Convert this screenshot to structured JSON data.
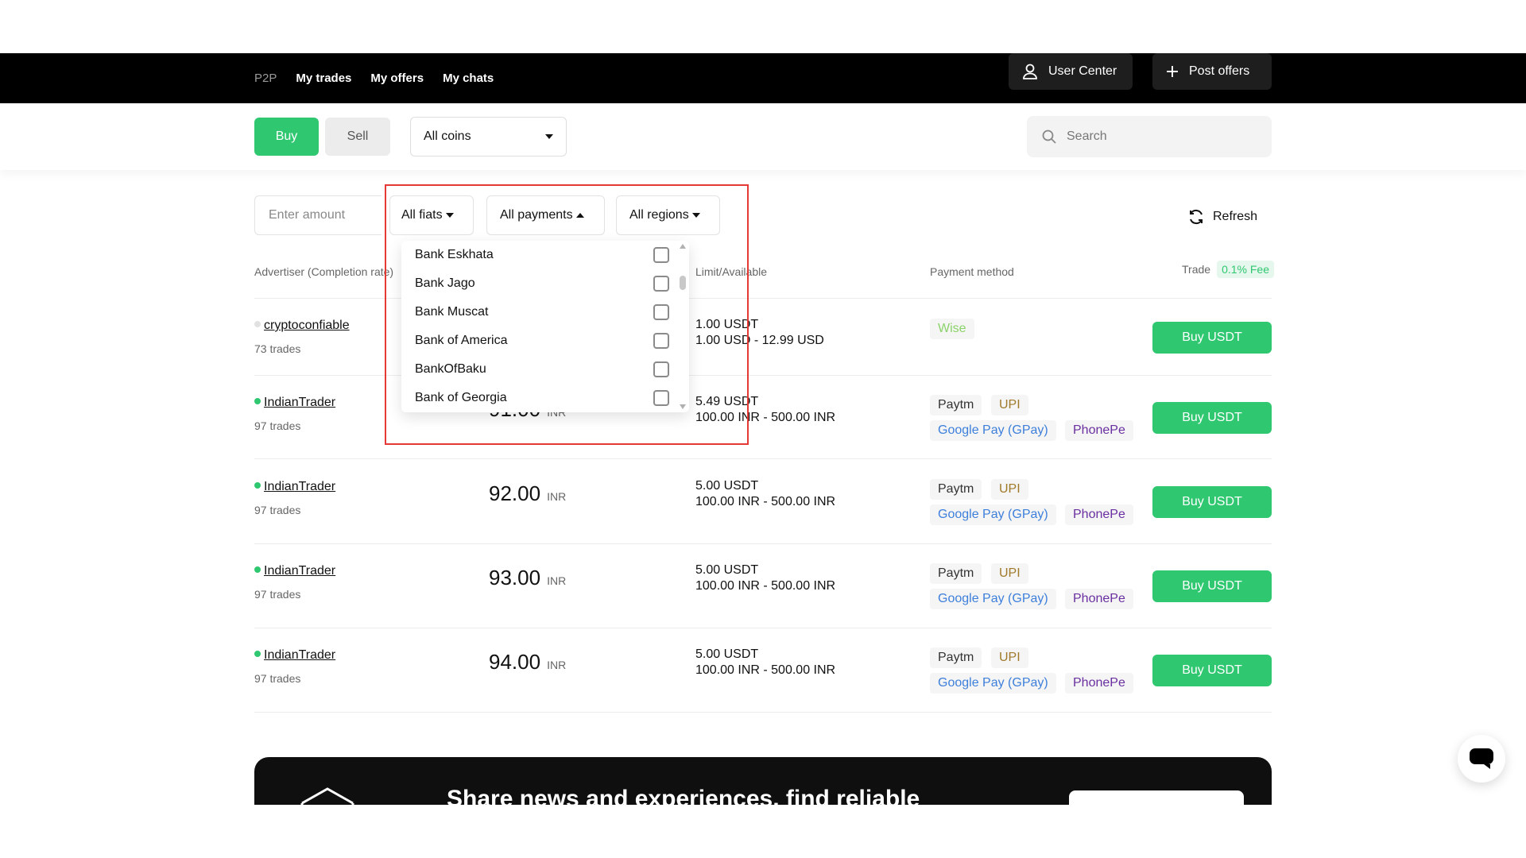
{
  "nav": {
    "p2p": "P2P",
    "my_trades": "My trades",
    "my_offers": "My offers",
    "my_chats": "My chats",
    "user_center": "User Center",
    "post_offers": "Post offers"
  },
  "filters": {
    "buy": "Buy",
    "sell": "Sell",
    "coins": "All coins",
    "search_placeholder": "Search",
    "amount_placeholder": "Enter amount",
    "fiats": "All fiats",
    "payments": "All payments",
    "regions": "All regions",
    "refresh": "Refresh"
  },
  "table_header": {
    "advertiser": "Advertiser (Completion rate)",
    "limit": "Limit/Available",
    "payment": "Payment method",
    "trade": "Trade",
    "fee": "0.1% Fee"
  },
  "dropdown_items": [
    "Bank Eskhata",
    "Bank Jago",
    "Bank Muscat",
    "Bank of America",
    "BankOfBaku",
    "Bank of Georgia"
  ],
  "rows": [
    {
      "name": "cryptoconfiable",
      "trades": "73 trades",
      "price": "",
      "currency": "",
      "available": "1.00 USDT",
      "range": "1.00 USD - 12.99 USD",
      "payments": [
        "Wise"
      ],
      "action": "Buy USDT"
    },
    {
      "name": "IndianTrader",
      "trades": "97 trades",
      "price": "91.00",
      "currency": "INR",
      "available": "5.49 USDT",
      "range": "100.00 INR - 500.00 INR",
      "payments": [
        "Paytm",
        "UPI",
        "Google Pay (GPay)",
        "PhonePe"
      ],
      "action": "Buy USDT"
    },
    {
      "name": "IndianTrader",
      "trades": "97 trades",
      "price": "92.00",
      "currency": "INR",
      "available": "5.00 USDT",
      "range": "100.00 INR - 500.00 INR",
      "payments": [
        "Paytm",
        "UPI",
        "Google Pay (GPay)",
        "PhonePe"
      ],
      "action": "Buy USDT"
    },
    {
      "name": "IndianTrader",
      "trades": "97 trades",
      "price": "93.00",
      "currency": "INR",
      "available": "5.00 USDT",
      "range": "100.00 INR - 500.00 INR",
      "payments": [
        "Paytm",
        "UPI",
        "Google Pay (GPay)",
        "PhonePe"
      ],
      "action": "Buy USDT"
    },
    {
      "name": "IndianTrader",
      "trades": "97 trades",
      "price": "94.00",
      "currency": "INR",
      "available": "5.00 USDT",
      "range": "100.00 INR - 500.00 INR",
      "payments": [
        "Paytm",
        "UPI",
        "Google Pay (GPay)",
        "PhonePe"
      ],
      "action": "Buy USDT"
    }
  ],
  "banner": {
    "text": "Share news and experiences, find reliable"
  },
  "colors": {
    "accent": "#2fc770",
    "nav_bg": "#000000",
    "highlight": "#e53935"
  },
  "icons": [
    "user-icon",
    "plus-icon",
    "search-icon",
    "refresh-icon",
    "chat-icon",
    "chevron-down-icon"
  ]
}
